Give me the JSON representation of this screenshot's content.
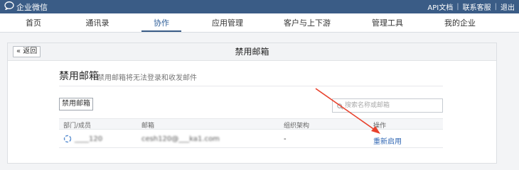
{
  "header": {
    "brand": "企业微信",
    "links": [
      "API文档",
      "联系客服",
      "退出"
    ]
  },
  "nav": {
    "items": [
      "首页",
      "通讯录",
      "协作",
      "应用管理",
      "客户与上下游",
      "管理工具",
      "我的企业"
    ],
    "active": "协作"
  },
  "panel": {
    "back_label": "« 返回",
    "title": "禁用邮箱",
    "section_title": "禁用邮箱",
    "section_desc": "禁用邮箱将无法登录和收发邮件",
    "disable_button": "禁用邮箱",
    "search_placeholder": "搜索名称或邮箱"
  },
  "table": {
    "columns": [
      "部门/成员",
      "邮箱",
      "组织架构",
      "操作"
    ],
    "rows": [
      {
        "member": "____120",
        "email": "cesh120@___ka1.com",
        "org": "-",
        "action": "重新启用"
      }
    ]
  },
  "colors": {
    "topbar": "#3a5c86",
    "accent": "#2f66b3",
    "arrow": "#e8412c"
  }
}
